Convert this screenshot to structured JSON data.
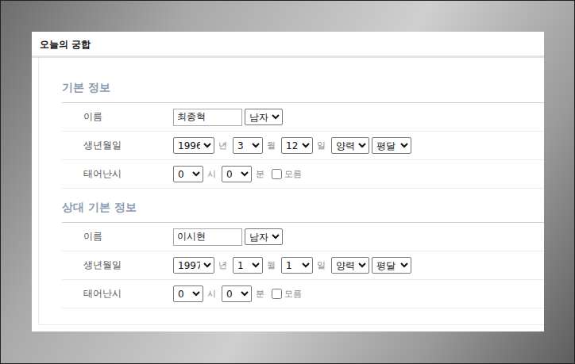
{
  "panel": {
    "title": "오늘의 궁합"
  },
  "sections": [
    {
      "heading": "기본 정보",
      "rows": [
        {
          "kind": "name",
          "label": "이름",
          "value": "최종혁",
          "gender": "남자"
        },
        {
          "kind": "date",
          "label": "생년월일",
          "year": "1996",
          "year_unit": "년",
          "month": "3",
          "month_unit": "월",
          "day": "12",
          "day_unit": "일",
          "calendar": "양력",
          "leap": "평달"
        },
        {
          "kind": "time",
          "label": "태어난시",
          "hour": "0",
          "hour_unit": "시",
          "minute": "0",
          "minute_unit": "분",
          "unknown_label": "모름",
          "unknown_checked": false
        }
      ]
    },
    {
      "heading": "상대 기본 정보",
      "rows": [
        {
          "kind": "name",
          "label": "이름",
          "value": "이시현",
          "gender": "남자"
        },
        {
          "kind": "date",
          "label": "생년월일",
          "year": "1997",
          "year_unit": "년",
          "month": "1",
          "month_unit": "월",
          "day": "1",
          "day_unit": "일",
          "calendar": "양력",
          "leap": "평달"
        },
        {
          "kind": "time",
          "label": "태어난시",
          "hour": "0",
          "hour_unit": "시",
          "minute": "0",
          "minute_unit": "분",
          "unknown_label": "모름",
          "unknown_checked": false
        }
      ]
    }
  ]
}
